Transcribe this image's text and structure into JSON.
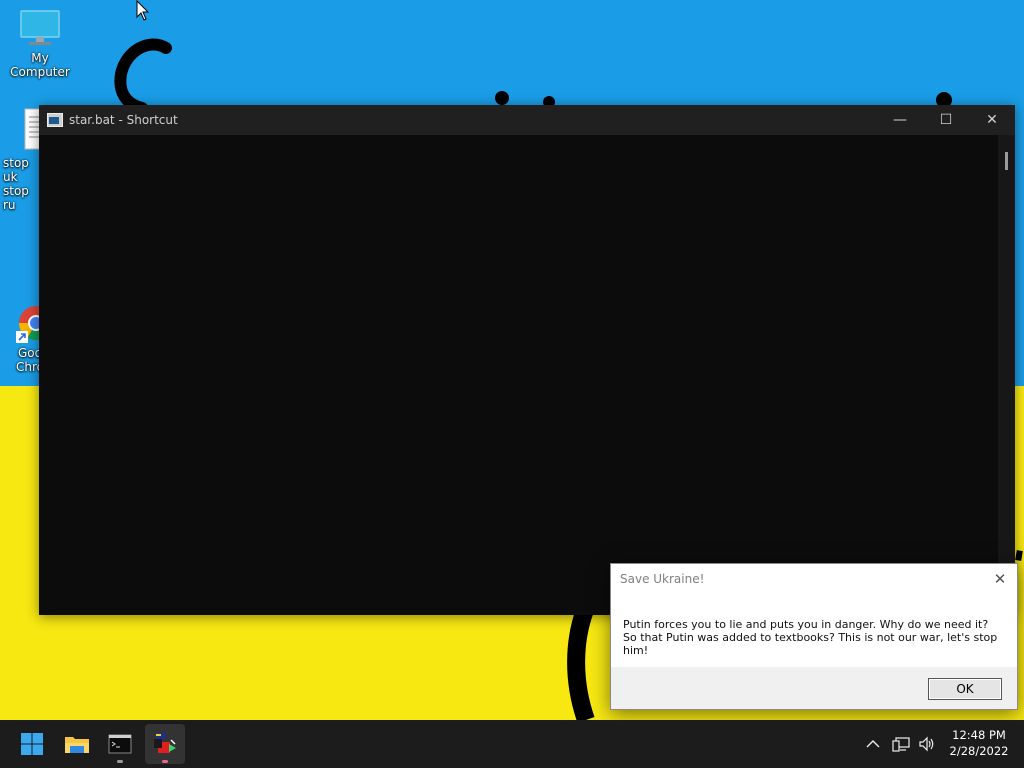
{
  "desktop": {
    "icons": [
      {
        "label": "My Computer",
        "icon": "monitor-icon"
      },
      {
        "label": "stop ukr stop ru",
        "line1": "stop uk",
        "line2": "stop ru",
        "icon": "text-file-icon"
      },
      {
        "label": "Google Chrome",
        "line1": "Goo",
        "line2": "Chro",
        "icon": "chrome-icon"
      }
    ],
    "wallpaper_colors": {
      "top": "#1a9de6",
      "bottom": "#f7e812"
    }
  },
  "console": {
    "title": "star.bat - Shortcut",
    "minimize": "—",
    "maximize": "☐",
    "close": "✕"
  },
  "dialog": {
    "title": "Save Ukraine!",
    "message": "Putin forces you to lie and puts you in danger. Why do we need it? So that Putin was added to textbooks? This is not our war, let's stop him!",
    "ok_label": "OK",
    "close": "✕"
  },
  "taskbar": {
    "apps": [
      "start-icon",
      "file-explorer-icon",
      "terminal-icon",
      "batch-app-icon"
    ],
    "tray": {
      "chevron": "^",
      "network_icon": "network-icon",
      "volume_icon": "volume-icon"
    },
    "time": "12:48 PM",
    "date": "2/28/2022"
  }
}
